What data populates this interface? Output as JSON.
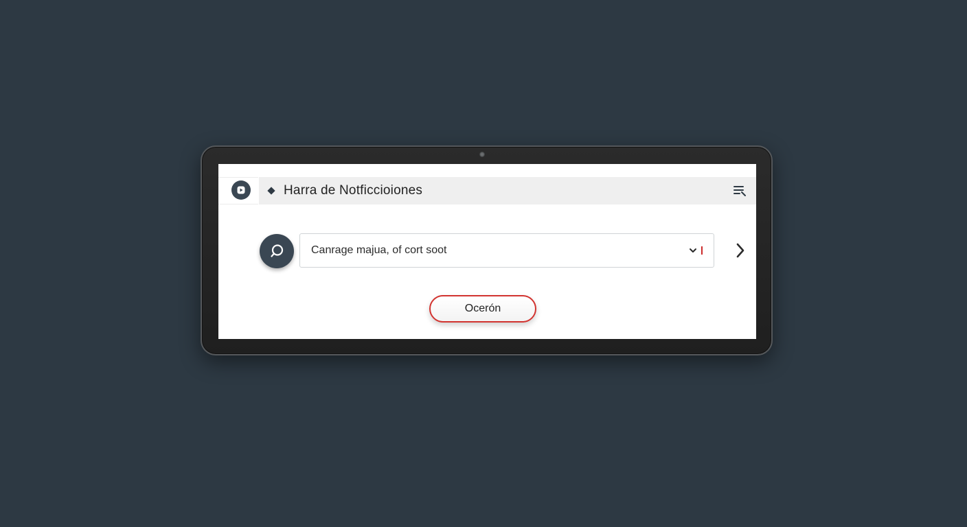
{
  "notification_bar": {
    "title": "Harra de Notficcioiones",
    "logo_icon": "app-logo-icon",
    "marker_icon": "diamond-icon",
    "menu_icon": "list-settings-icon"
  },
  "search": {
    "button_icon": "chat-search-icon",
    "dropdown_value": "Canrage majua, of cort soot",
    "dropdown_icon": "chevron-down-icon",
    "next_icon": "chevron-right-icon"
  },
  "action": {
    "button_label": "Ocerón"
  },
  "colors": {
    "background": "#2d3943",
    "accent_red": "#d2332f",
    "dark_slate": "#3a4753",
    "bar_gray": "#efefef"
  }
}
